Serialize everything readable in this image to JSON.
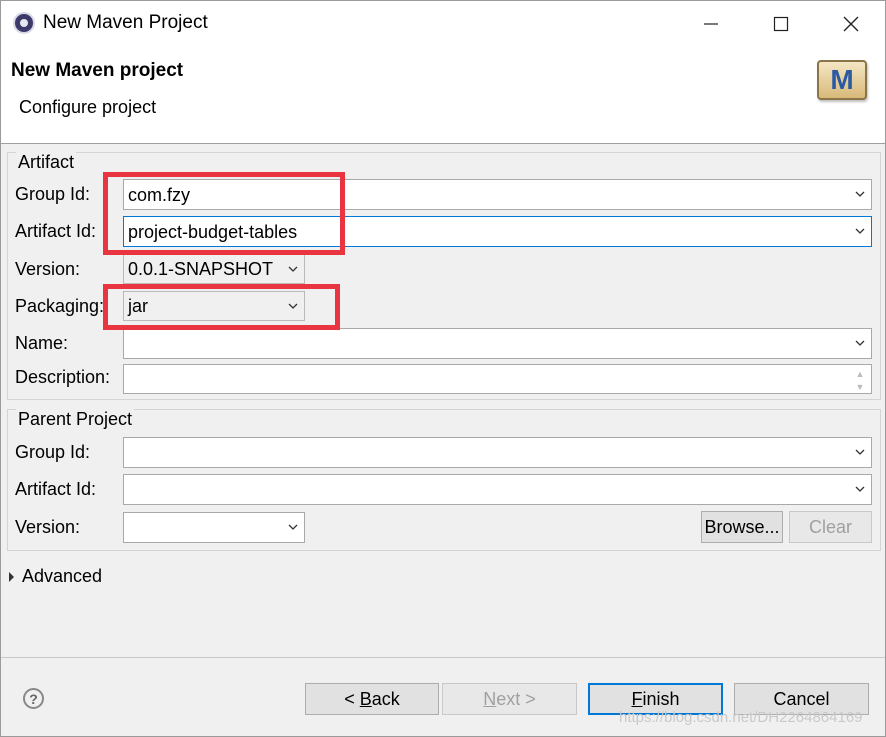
{
  "window": {
    "title": "New Maven Project",
    "controls": {
      "minimize": "—",
      "maximize": "☐",
      "close": "✕"
    }
  },
  "header": {
    "title": "New Maven project",
    "subtitle": "Configure project",
    "logo_letter": "M"
  },
  "artifact": {
    "legend": "Artifact",
    "group_id": {
      "label": "Group Id:",
      "value": "com.fzy"
    },
    "artifact_id": {
      "label": "Artifact Id:",
      "value": "project-budget-tables"
    },
    "version": {
      "label": "Version:",
      "value": "0.0.1-SNAPSHOT"
    },
    "packaging": {
      "label": "Packaging:",
      "value": "jar"
    },
    "name": {
      "label": "Name:",
      "value": ""
    },
    "description": {
      "label": "Description:",
      "value": ""
    }
  },
  "parent": {
    "legend": "Parent Project",
    "group_id": {
      "label": "Group Id:",
      "value": ""
    },
    "artifact_id": {
      "label": "Artifact Id:",
      "value": ""
    },
    "version": {
      "label": "Version:",
      "value": ""
    },
    "browse_label": "Browse...",
    "clear_label": "Clear"
  },
  "advanced": {
    "label": "Advanced"
  },
  "footer": {
    "help": "?",
    "back": {
      "prefix": "< ",
      "mnemonic": "B",
      "rest": "ack"
    },
    "next": {
      "mnemonic": "N",
      "rest": "ext >"
    },
    "finish": {
      "mnemonic": "F",
      "rest": "inish"
    },
    "cancel": "Cancel"
  },
  "watermark": "https://blog.csdn.net/DH2264864169",
  "colors": {
    "highlight": "#e8353f",
    "focus": "#0078d7"
  }
}
